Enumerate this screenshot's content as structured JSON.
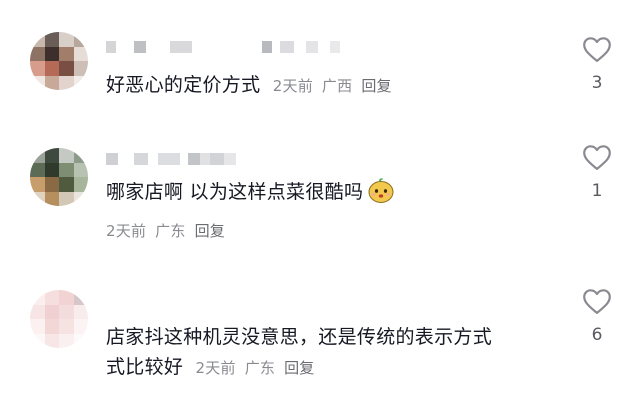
{
  "comments": [
    {
      "text": "好恶心的定价方式",
      "time": "2天前",
      "location": "广西",
      "reply_label": "回复",
      "likes": "3"
    },
    {
      "text": "哪家店啊 以为这样点菜很酷吗",
      "emoji": "mango-face-emoji",
      "time": "2天前",
      "location": "广东",
      "reply_label": "回复",
      "likes": "1"
    },
    {
      "text_line1": "店家抖这种机灵没意思，还是传统的表示方式",
      "text_line2": "式比较好",
      "time": "2天前",
      "location": "广东",
      "reply_label": "回复",
      "likes": "6"
    }
  ],
  "icons": {
    "like": "heart-outline-icon"
  },
  "colors": {
    "text": "#161823",
    "meta": "#8a8b91",
    "heart": "#8a8b91"
  }
}
